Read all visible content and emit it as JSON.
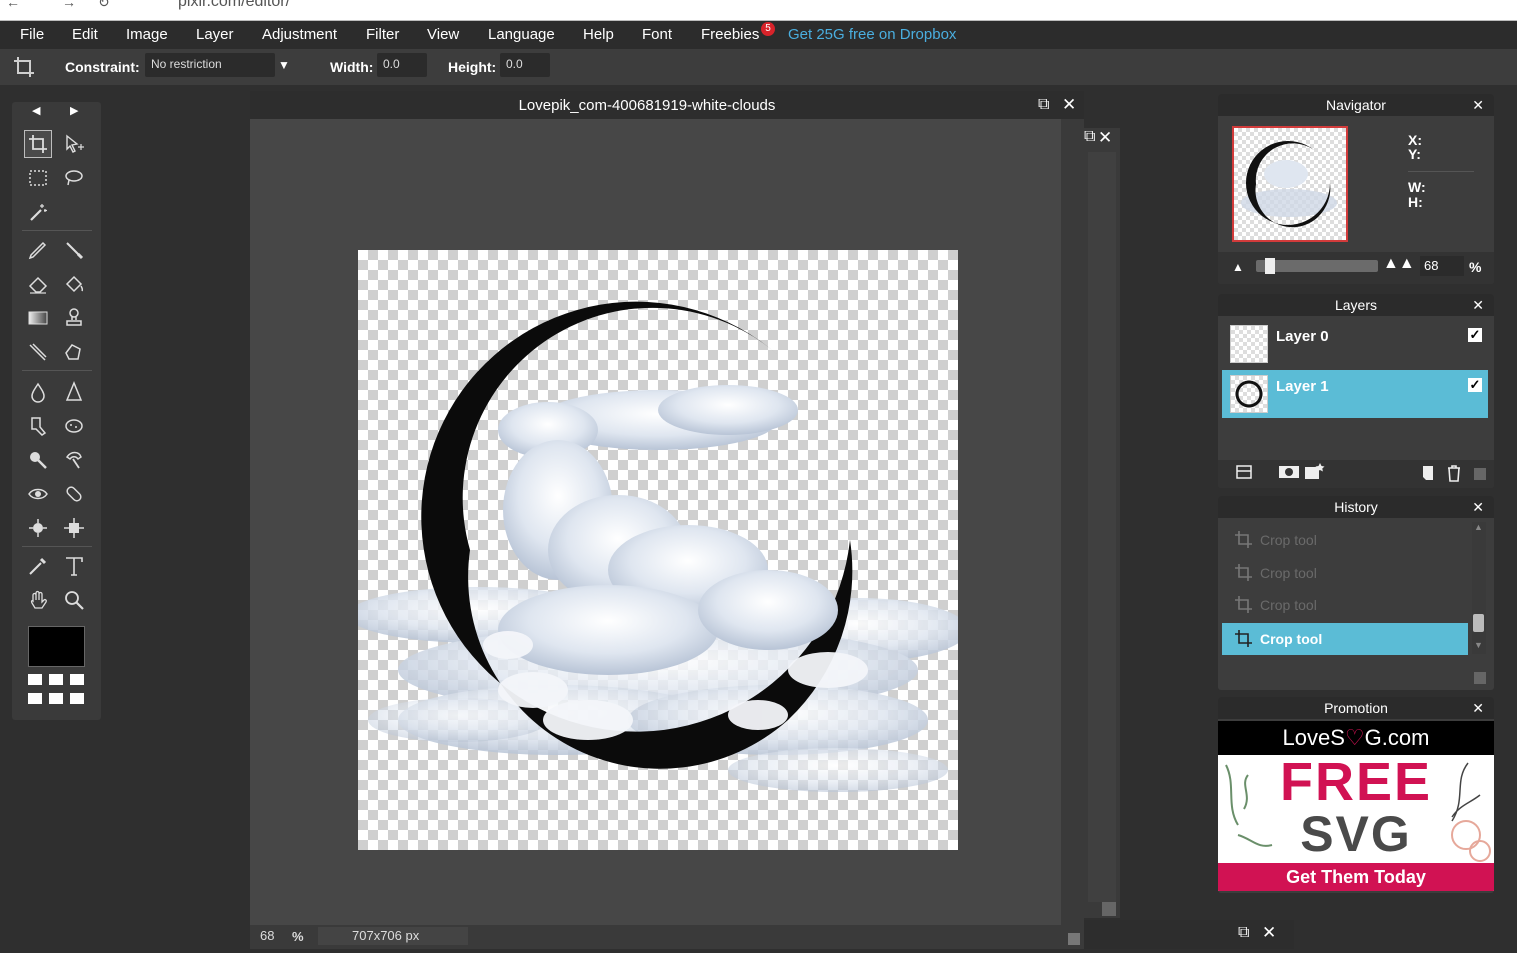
{
  "browser": {
    "url": "pixlr.com/editor/"
  },
  "menu": {
    "items": [
      "File",
      "Edit",
      "Image",
      "Layer",
      "Adjustment",
      "Filter",
      "View",
      "Language",
      "Help",
      "Font",
      "Freebies"
    ],
    "freebies_badge": "5",
    "dropbox_link": "Get 25G free on Dropbox"
  },
  "options": {
    "constraint_label": "Constraint:",
    "constraint_value": "No restriction",
    "width_label": "Width:",
    "width_value": "0.0",
    "height_label": "Height:",
    "height_value": "0.0"
  },
  "document": {
    "title": "Lovepik_com-400681919-white-clouds",
    "zoom": "68",
    "zoom_unit": "%",
    "dimensions": "707x706 px"
  },
  "navigator": {
    "title": "Navigator",
    "x_label": "X:",
    "y_label": "Y:",
    "w_label": "W:",
    "h_label": "H:",
    "zoom": "68",
    "zoom_unit": "%",
    "zoom_level": 0.08
  },
  "layers": {
    "title": "Layers",
    "items": [
      {
        "name": "Layer 0",
        "selected": false
      },
      {
        "name": "Layer 1",
        "selected": true
      }
    ]
  },
  "history": {
    "title": "History",
    "items": [
      {
        "label": "Crop tool",
        "active": false
      },
      {
        "label": "Crop tool",
        "active": false
      },
      {
        "label": "Crop tool",
        "active": false
      },
      {
        "label": "Crop tool",
        "active": true
      }
    ]
  },
  "promotion": {
    "title": "Promotion",
    "brand_left": "LoveS",
    "brand_right": "G.com",
    "line1": "FREE",
    "line2": "SVG",
    "cta": "Get Them Today"
  },
  "colors": {
    "accent": "#5bbcd6",
    "link": "#4aaedf",
    "badge": "#d8232a",
    "promo_red": "#d11253"
  }
}
